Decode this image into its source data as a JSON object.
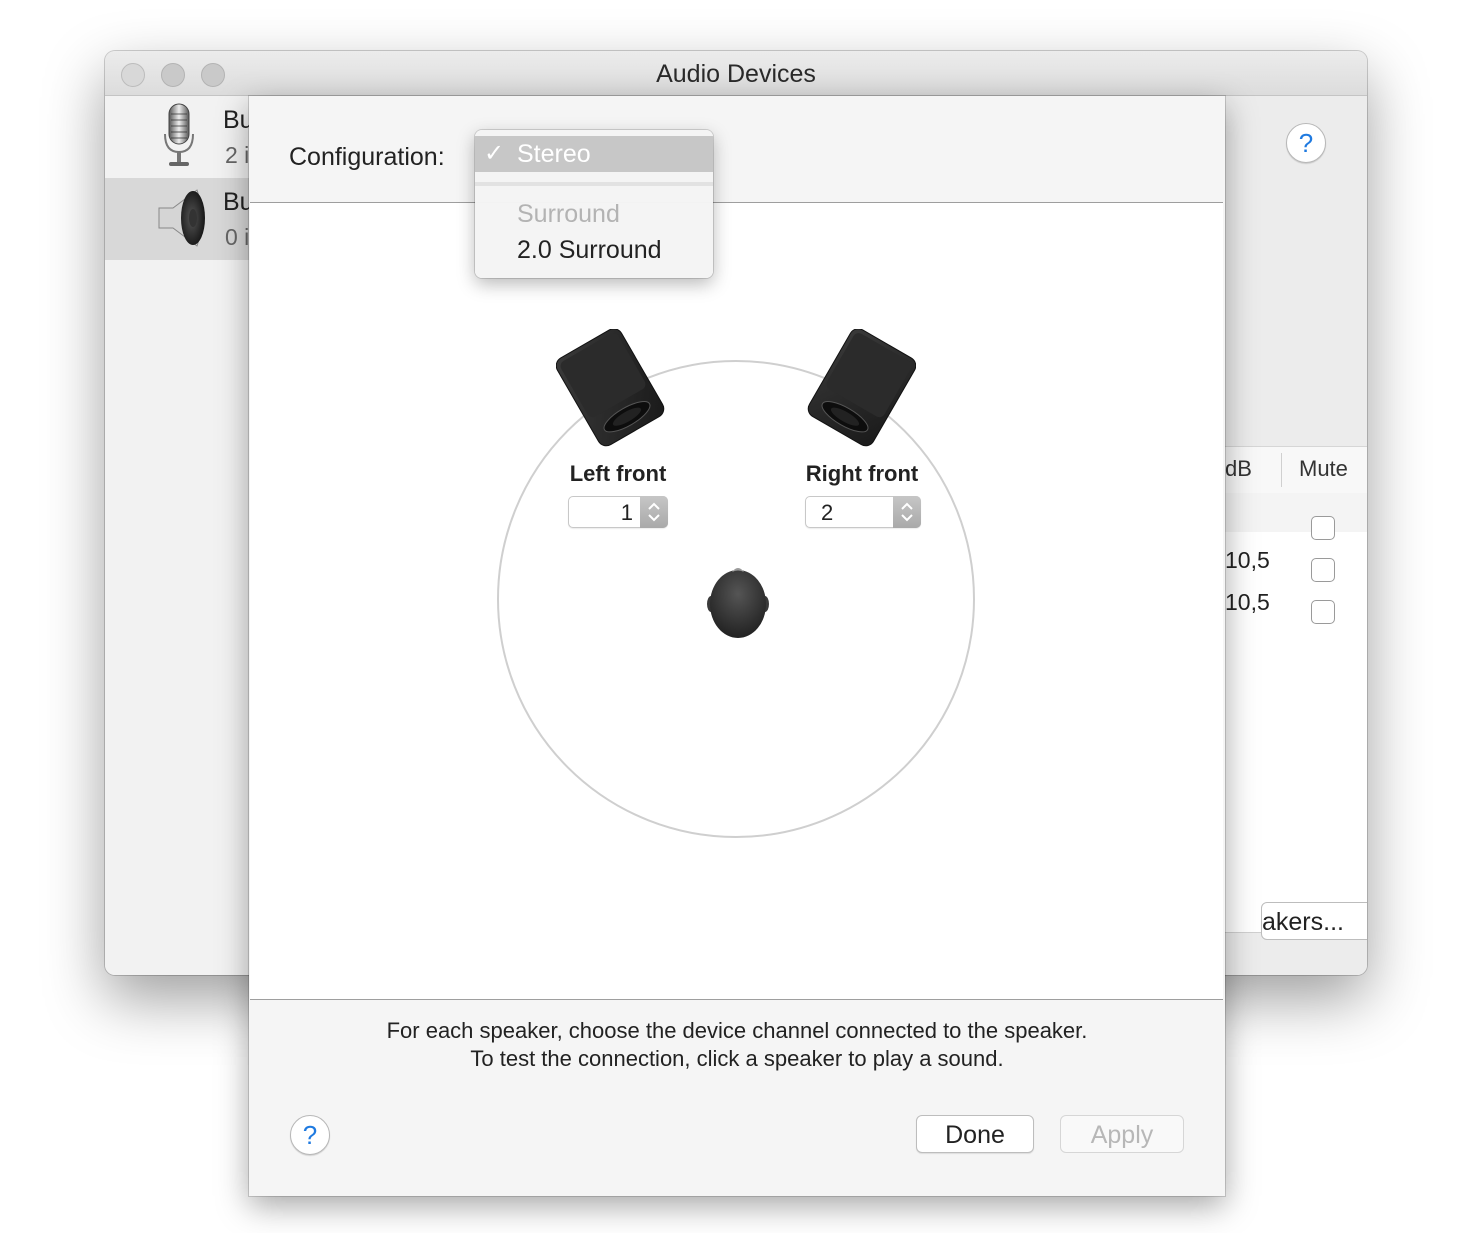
{
  "window": {
    "title": "Audio Devices"
  },
  "sidebar": {
    "devices": [
      {
        "name": "Bu",
        "sub": "2 i",
        "icon": "microphone-icon"
      },
      {
        "name": "Bu",
        "sub": "0 i",
        "icon": "speaker-icon",
        "selected": true
      }
    ],
    "toolbar": {
      "add": "+",
      "remove": "—",
      "action": "gear-icon"
    }
  },
  "right_pane": {
    "help_label": "?",
    "columns": {
      "db": "dB",
      "mute": "Mute"
    },
    "rows": [
      {
        "value": "",
        "mute": false
      },
      {
        "value": "10,5",
        "mute": false
      },
      {
        "value": "10,5",
        "mute": false
      }
    ],
    "configure_button": "akers..."
  },
  "sheet": {
    "config_label": "Configuration:",
    "menu": {
      "selected": "Stereo",
      "check": "✓",
      "items": [
        "Surround",
        "2.0 Surround"
      ]
    },
    "speakers": {
      "left": {
        "label": "Left front",
        "channel": "1"
      },
      "right": {
        "label": "Right front",
        "channel": "2"
      }
    },
    "instructions": [
      "For each speaker, choose the device channel connected to the speaker.",
      "To test the connection, click a speaker to play a sound."
    ],
    "help_label": "?",
    "done_label": "Done",
    "apply_label": "Apply"
  },
  "colors": {
    "accent_blue": "#1f7ae0",
    "menu_highlight": "#c7c7c7",
    "disabled_text": "#b7b7b7"
  }
}
